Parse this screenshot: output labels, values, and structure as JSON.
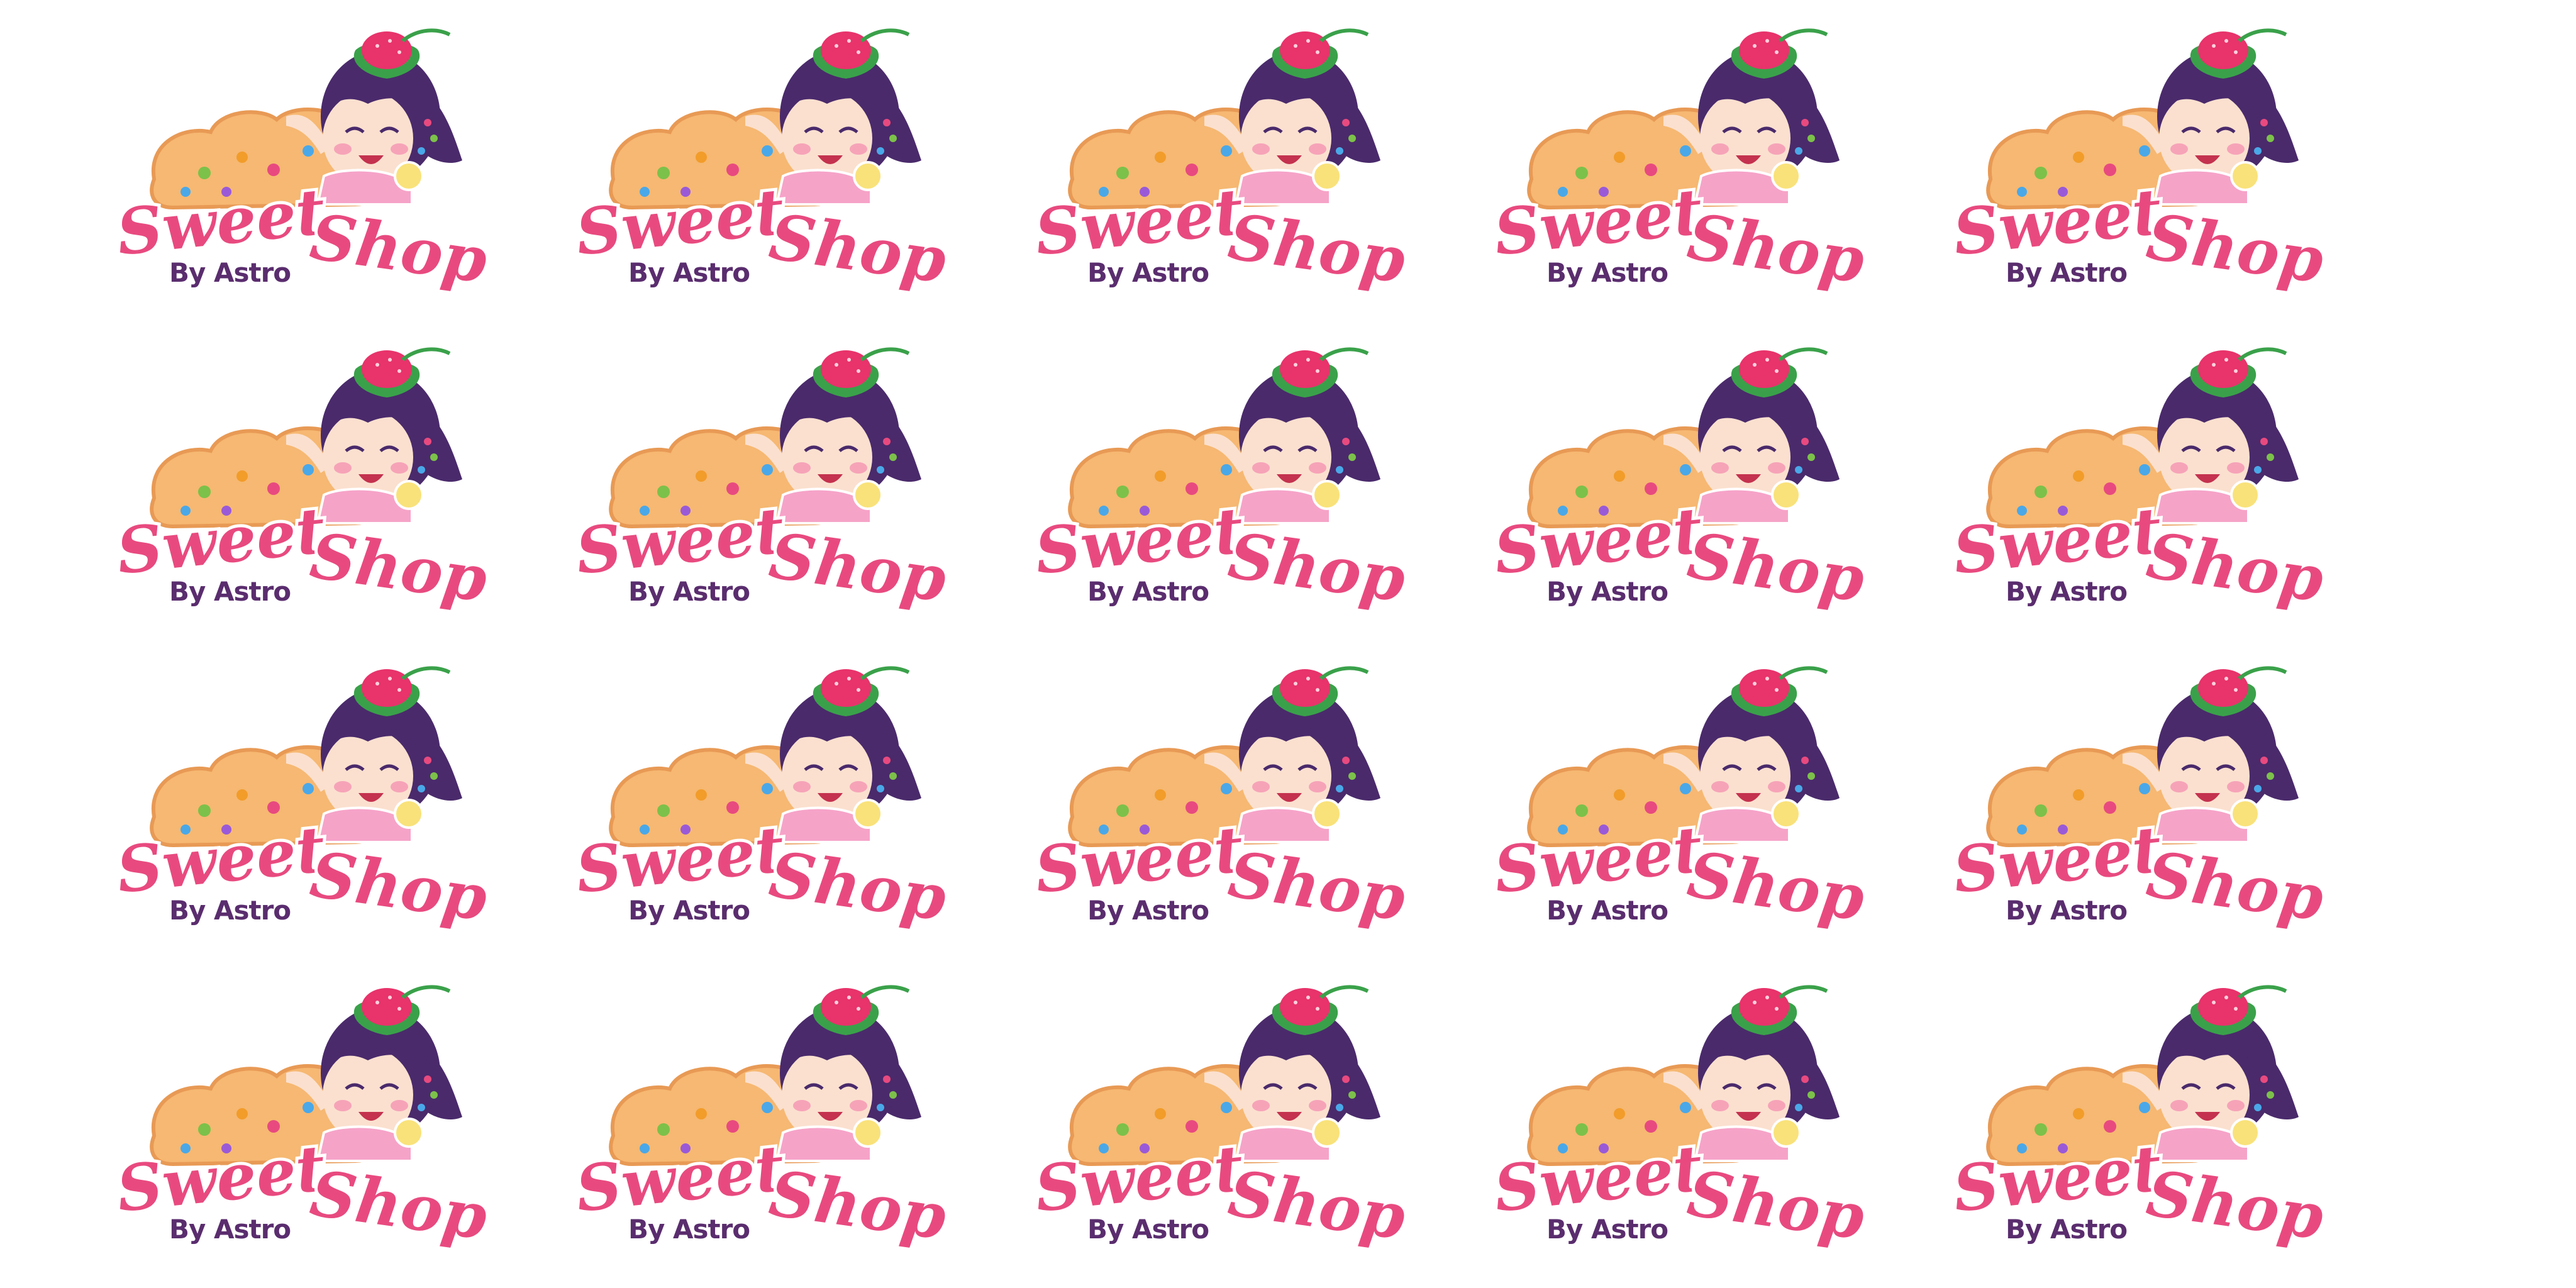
{
  "sprite_sheet": {
    "frame": {
      "logo_word_1": "Sweet",
      "logo_word_2": "Shop",
      "byline": "By Astro"
    },
    "rows": 4,
    "columns": 5,
    "colors": {
      "background": "#ffffff",
      "logo_pink": "#e84a7f",
      "logo_outline": "#ffffff",
      "byline_purple": "#5a2d6e",
      "cookie": "#f6b872",
      "cookie_shadow": "#e89a55",
      "hair": "#4a2a6b",
      "skin": "#fbe0cf",
      "strawberry": "#e8336b",
      "leaf": "#3aa14a"
    },
    "icons": [
      "cookie-icon",
      "girl-character-icon",
      "strawberry-icon"
    ]
  }
}
